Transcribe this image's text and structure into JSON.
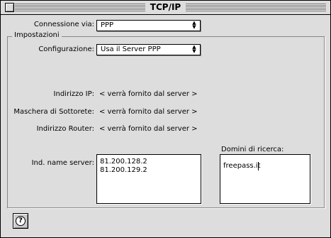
{
  "window": {
    "title": "TCP/IP"
  },
  "connection": {
    "label": "Connessione via:",
    "value": "PPP"
  },
  "settings": {
    "group_title": "Impostazioni",
    "config_label": "Configurazione:",
    "config_value": "Usa il Server PPP",
    "ip_label": "Indirizzo IP:",
    "ip_value": "< verrà fornito dal server >",
    "mask_label": "Maschera di Sottorete:",
    "mask_value": "< verrà fornito dal server >",
    "router_label": "Indirizzo Router:",
    "router_value": "< verrà fornito dal server >",
    "nameserver_label": "Ind. name server:",
    "nameservers": [
      "81.200.128.2",
      "81.200.129.2"
    ],
    "search_domains_label": "Domini di ricerca:",
    "search_domains": [
      "freepass.it"
    ]
  },
  "help": {
    "icon": "help-icon",
    "glyph": "?"
  }
}
